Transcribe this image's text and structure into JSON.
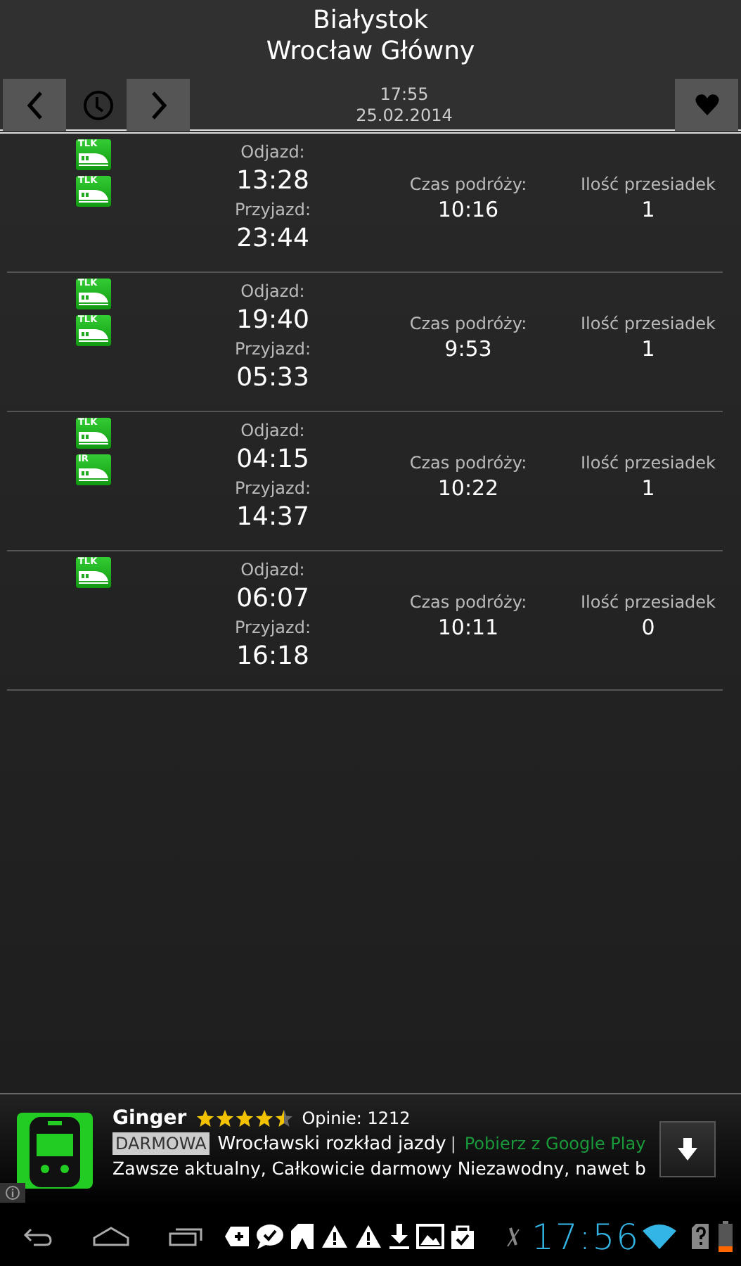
{
  "header": {
    "from": "Białystok",
    "to": "Wrocław Główny",
    "time": "17:55",
    "date": "25.02.2014"
  },
  "connections": [
    {
      "trains": [
        {
          "label": "TLK"
        },
        {
          "label": "TLK"
        }
      ],
      "departure_label": "Odjazd:",
      "departure": "13:28",
      "arrival_label": "Przyjazd:",
      "arrival": "23:44",
      "duration_label": "Czas podróży:",
      "duration": "10:16",
      "transfers_label": "Ilość przesiadek",
      "transfers": "1"
    },
    {
      "trains": [
        {
          "label": "TLK"
        },
        {
          "label": "TLK"
        }
      ],
      "departure_label": "Odjazd:",
      "departure": "19:40",
      "arrival_label": "Przyjazd:",
      "arrival": "05:33",
      "duration_label": "Czas podróży:",
      "duration": "9:53",
      "transfers_label": "Ilość przesiadek",
      "transfers": "1"
    },
    {
      "trains": [
        {
          "label": "TLK"
        },
        {
          "label": "IR"
        }
      ],
      "departure_label": "Odjazd:",
      "departure": "04:15",
      "arrival_label": "Przyjazd:",
      "arrival": "14:37",
      "duration_label": "Czas podróży:",
      "duration": "10:22",
      "transfers_label": "Ilość przesiadek",
      "transfers": "1"
    },
    {
      "trains": [
        {
          "label": "TLK"
        }
      ],
      "departure_label": "Odjazd:",
      "departure": "06:07",
      "arrival_label": "Przyjazd:",
      "arrival": "16:18",
      "duration_label": "Czas podróży:",
      "duration": "10:11",
      "transfers_label": "Ilość przesiadek",
      "transfers": "0"
    }
  ],
  "ad": {
    "app_name": "Ginger",
    "stars": 4.5,
    "reviews": "Opinie: 1212",
    "badge": "DARMOWA",
    "headline": "Wrocławski rozkład jazdy",
    "separator": "|",
    "cta": "Pobierz z Google Play",
    "description": "Zawsze aktualny, Całkowicie darmowy Niezawodny, nawet b"
  },
  "status_bar": {
    "time": "17:56"
  }
}
